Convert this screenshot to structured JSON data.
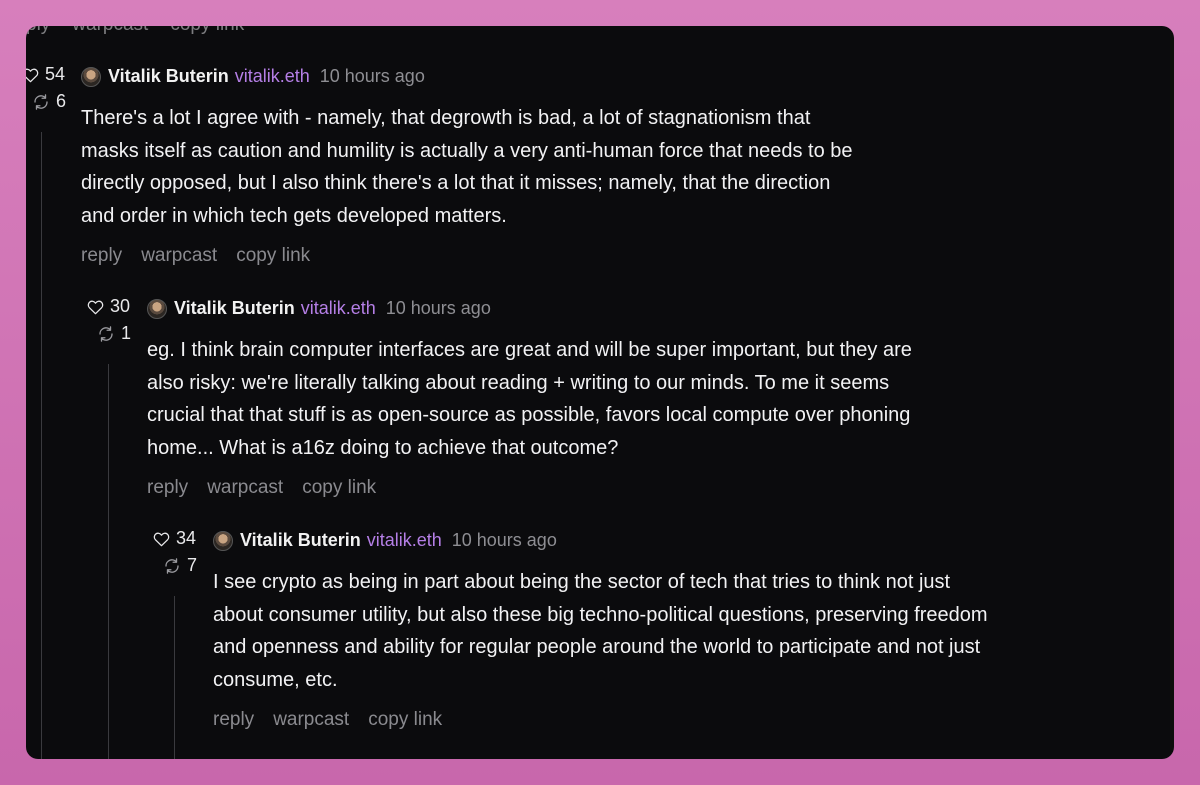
{
  "cut_actions": {
    "reply": "ply",
    "warpcast": "warpcast",
    "copy_link": "copy link"
  },
  "comments": [
    {
      "likes": "54",
      "recasts": "6",
      "author": "Vitalik Buterin",
      "handle": "vitalik.eth",
      "time": "10 hours ago",
      "text_lines": [
        "There's a lot I agree with - namely, that degrowth is bad, a lot of stagnationism that",
        "masks itself as caution and humility is actually a very anti-human force that needs to be",
        "directly opposed, but I also think there's a lot that it misses; namely, that the direction",
        "and order in which tech gets developed matters."
      ],
      "actions": {
        "reply": "reply",
        "warpcast": "warpcast",
        "copy_link": "copy link"
      }
    },
    {
      "likes": "30",
      "recasts": "1",
      "author": "Vitalik Buterin",
      "handle": "vitalik.eth",
      "time": "10 hours ago",
      "text_lines": [
        "eg. I think brain computer interfaces are great and will be super important, but they are",
        "also risky: we're literally talking about reading + writing to our minds. To me it seems",
        "crucial that that stuff is as open-source as possible, favors local compute over phoning",
        "home... What is a16z doing to achieve that outcome?"
      ],
      "actions": {
        "reply": "reply",
        "warpcast": "warpcast",
        "copy_link": "copy link"
      }
    },
    {
      "likes": "34",
      "recasts": "7",
      "author": "Vitalik Buterin",
      "handle": "vitalik.eth",
      "time": "10 hours ago",
      "text_lines": [
        "I see crypto as being in part about being the sector of tech that tries to think not just",
        "about consumer utility, but also these big techno-political questions, preserving freedom",
        "and openness and ability for regular people around the world to participate and not just",
        "consume, etc."
      ],
      "actions": {
        "reply": "reply",
        "warpcast": "warpcast",
        "copy_link": "copy link"
      }
    }
  ],
  "colors": {
    "handle": "#b57fe6",
    "background": "#0b0b0d",
    "frame": "#d77fbc"
  },
  "icons": {
    "like": "heart-icon",
    "recast": "recast-icon",
    "avatar": "avatar"
  }
}
